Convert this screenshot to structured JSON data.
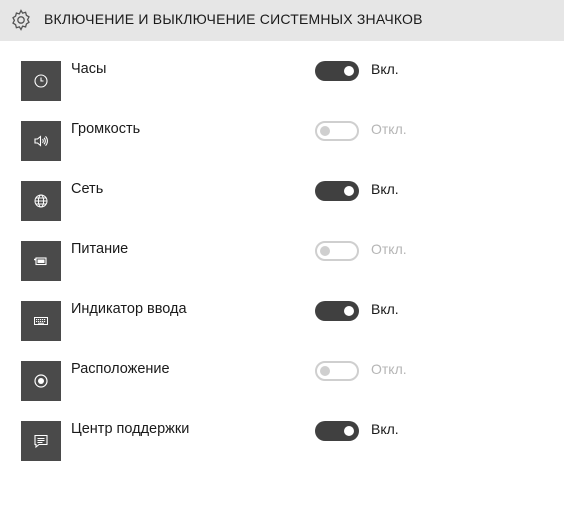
{
  "header": {
    "icon": "gear-icon",
    "title": "ВКЛЮЧЕНИЕ И ВЫКЛЮЧЕНИЕ СИСТЕМНЫХ ЗНАЧКОВ"
  },
  "items": [
    {
      "label": "Часы",
      "icon": "clock-icon",
      "on": true,
      "state": "Вкл."
    },
    {
      "label": "Громкость",
      "icon": "volume-icon",
      "on": false,
      "state": "Откл."
    },
    {
      "label": "Сеть",
      "icon": "network-globe-icon",
      "on": true,
      "state": "Вкл."
    },
    {
      "label": "Питание",
      "icon": "battery-icon",
      "on": false,
      "state": "Откл."
    },
    {
      "label": "Индикатор ввода",
      "icon": "keyboard-icon",
      "on": true,
      "state": "Вкл."
    },
    {
      "label": "Расположение",
      "icon": "location-icon",
      "on": false,
      "state": "Откл."
    },
    {
      "label": "Центр поддержки",
      "icon": "action-center-icon",
      "on": true,
      "state": "Вкл."
    }
  ],
  "colors": {
    "header_bg": "#e6e6e6",
    "icon_tile_bg": "#4a4a4a",
    "toggle_on": "#404040",
    "toggle_off_border": "#cfcfcf",
    "state_off_text": "#b5b5b5"
  }
}
